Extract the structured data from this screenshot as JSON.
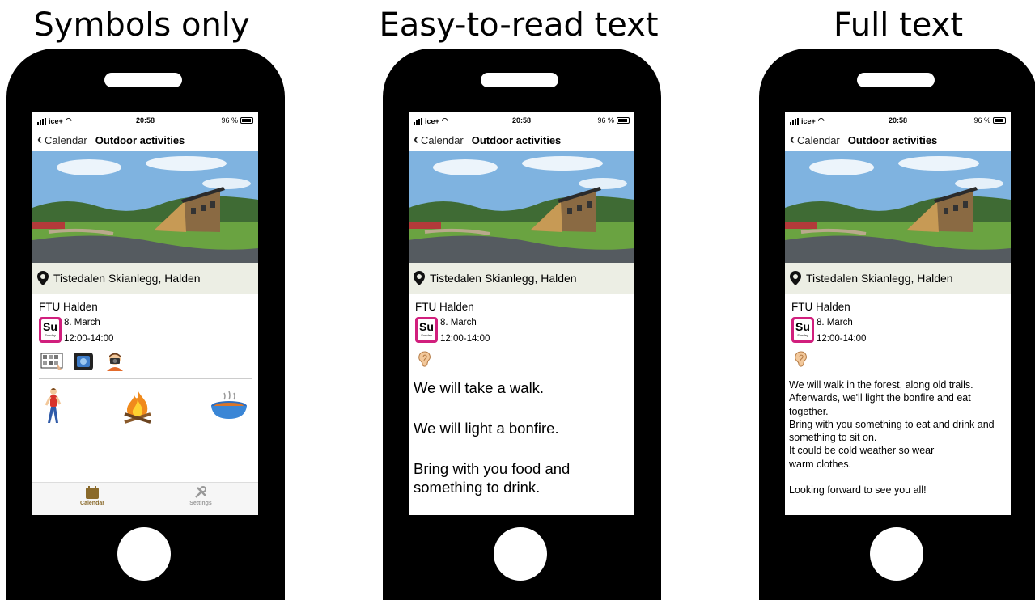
{
  "columns": [
    {
      "title": "Symbols only"
    },
    {
      "title": "Easy-to-read text"
    },
    {
      "title": "Full text"
    }
  ],
  "status": {
    "carrier": "ice+",
    "time": "20:58",
    "battery": "96 %"
  },
  "nav": {
    "back_label": "Calendar",
    "title": "Outdoor activities"
  },
  "event": {
    "location": "Tistedalen Skianlegg, Halden",
    "organizer": "FTU Halden",
    "day_abbr": "Su",
    "day_name": "Sunday",
    "date": "8. March",
    "time": "12:00-14:00"
  },
  "symbols_tabs": {
    "calendar": "Calendar",
    "settings": "Settings"
  },
  "easy_text": [
    "We will take a walk.",
    "We will light a bonfire.",
    "Bring with you food and something to drink."
  ],
  "full_text": [
    "We will walk in the forest, along old trails.",
    "Afterwards, we'll light the bonfire and eat together.",
    "Bring with you something to eat and drink and something to sit on.",
    "It could be cold weather so wear warm clothes.",
    "",
    "Looking forward to see you all!"
  ],
  "colors": {
    "calendar_accent": "#d11f7d",
    "tab_active": "#8a6a2b"
  }
}
